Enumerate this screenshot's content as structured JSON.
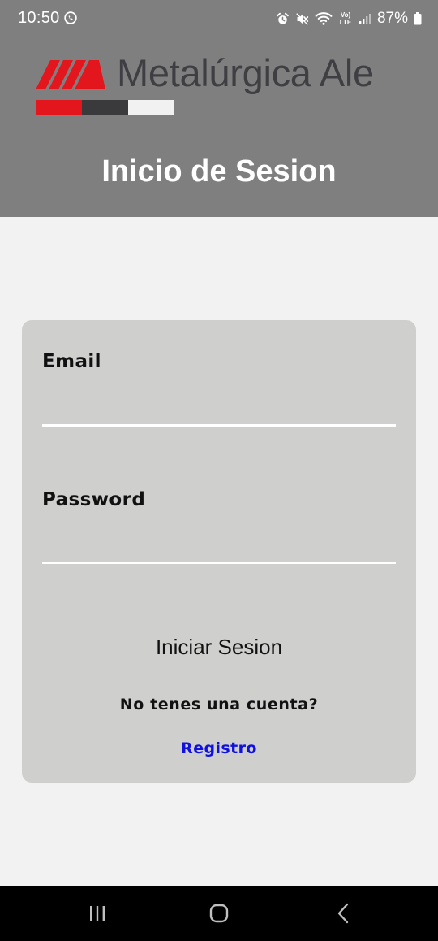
{
  "status_bar": {
    "time": "10:50",
    "battery": "87%",
    "icons": [
      "whatsapp-icon",
      "alarm-icon",
      "mute-icon",
      "wifi-icon",
      "volte-icon",
      "signal-icon",
      "battery-icon"
    ],
    "volte_line1": "Vo)",
    "volte_line2": "LTE"
  },
  "header": {
    "logo_text": "Metalúrgica Ale",
    "title": "Inicio de Sesion",
    "bg_color": "#7f7f7f"
  },
  "form": {
    "email_label": "Email",
    "email_value": "",
    "password_label": "Password",
    "password_value": "",
    "login_button": "Iniciar Sesion",
    "no_account_text": "No tenes una cuenta?",
    "register_link": "Registro"
  },
  "colors": {
    "brand_red": "#e3161e",
    "brand_dark": "#3a3a3d",
    "link_blue": "#1010e0",
    "card_bg": "#cfd0ce"
  },
  "nav_bar": {
    "buttons": [
      "recents-icon",
      "home-icon",
      "back-icon"
    ]
  }
}
